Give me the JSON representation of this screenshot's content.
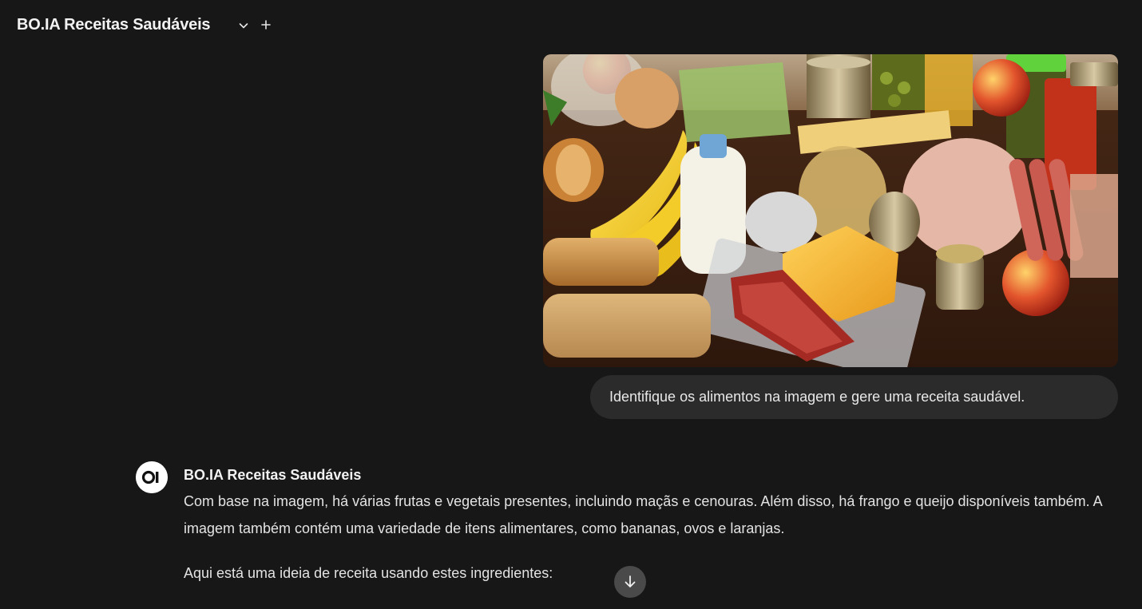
{
  "header": {
    "model_name": "BO.IA Receitas Saudáveis",
    "dropdown_icon": "chevron-down-icon",
    "new_chat_icon": "plus-icon"
  },
  "user_message": {
    "image_icon": "food-groceries-image",
    "text": "Identifique os alimentos na imagem e gere uma receita saudável."
  },
  "assistant_message": {
    "avatar_text": "OI",
    "name": "BO.IA Receitas Saudáveis",
    "paragraphs": [
      "Com base na imagem, há várias frutas e vegetais presentes, incluindo maçãs e cenouras. Além disso, há frango e queijo disponíveis também. A imagem também contém uma variedade de itens alimentares, como bananas, ovos e laranjas.",
      "Aqui está uma ideia de receita usando estes ingredientes:"
    ]
  },
  "scroll_button": {
    "icon": "arrow-down-icon"
  },
  "colors": {
    "background": "#171717",
    "bubble": "#2b2b2b",
    "text": "#e3e3e3",
    "scroll_button": "#4a4a4a"
  }
}
